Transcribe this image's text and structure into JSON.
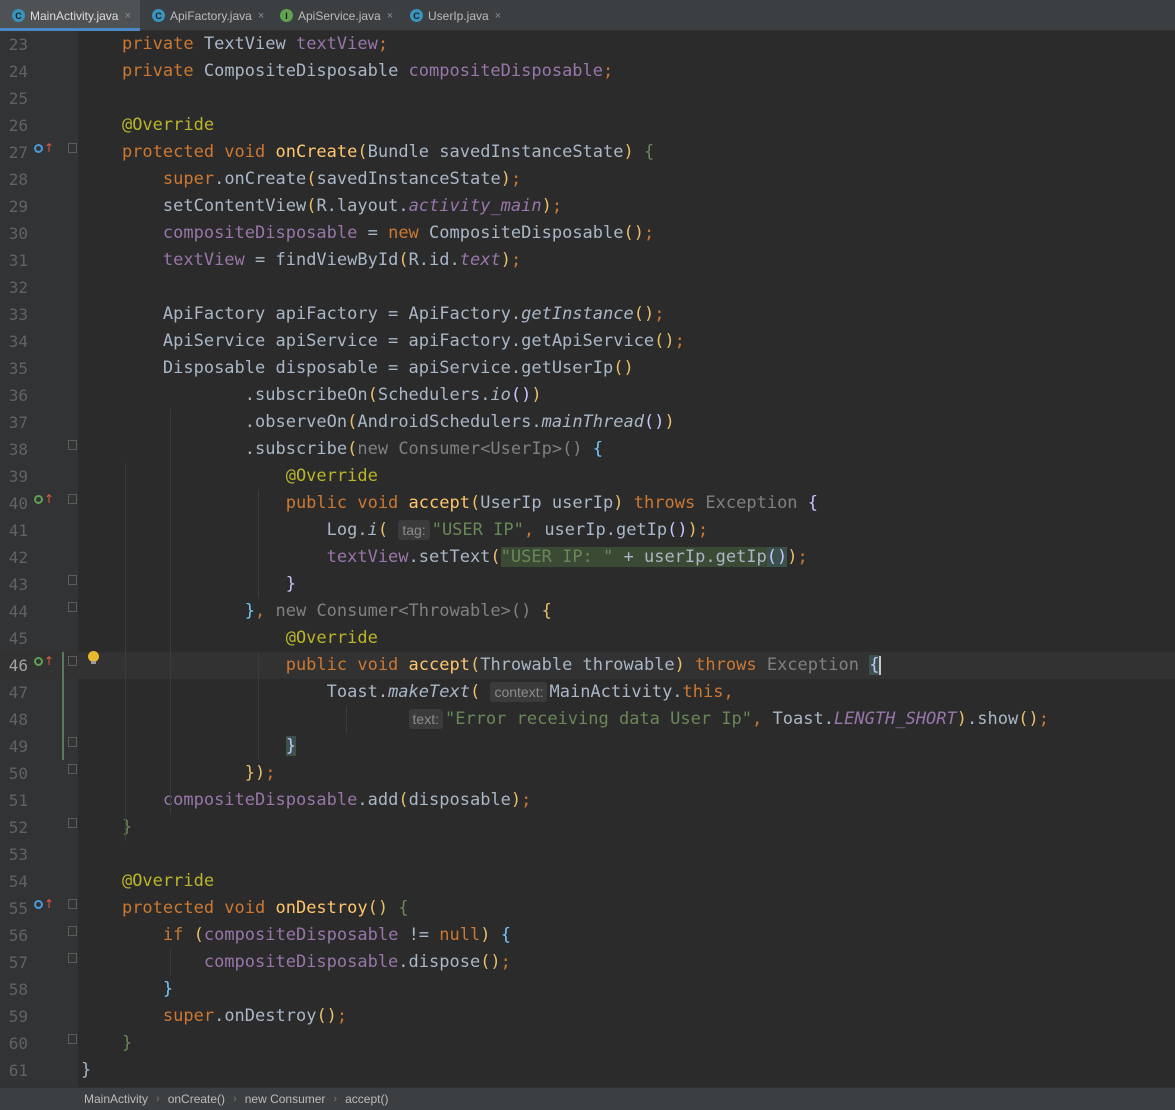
{
  "tabs": [
    {
      "label": "MainActivity.java",
      "icon": "C",
      "icon_name": "class-icon",
      "active": true
    },
    {
      "label": "ApiFactory.java",
      "icon": "C",
      "icon_name": "class-icon",
      "active": false
    },
    {
      "label": "ApiService.java",
      "icon": "I",
      "icon_name": "interface-icon",
      "active": false
    },
    {
      "label": "UserIp.java",
      "icon": "C",
      "icon_name": "class-icon",
      "active": false
    }
  ],
  "close_glyph": "×",
  "breadcrumb": [
    "MainActivity",
    "onCreate()",
    "new Consumer",
    "accept()"
  ],
  "breadcrumb_separator": "›",
  "current_line": 46,
  "colors": {
    "keyword": "#cc7832",
    "method": "#ffc66d",
    "field": "#9876aa",
    "annotation": "#bbb529",
    "string": "#6a8759",
    "background": "#2b2b2b"
  },
  "code": [
    {
      "n": "23",
      "t": [
        [
          "    ",
          ""
        ],
        [
          "private ",
          "k"
        ],
        [
          "TextView ",
          ""
        ],
        [
          "textView",
          "fd"
        ],
        [
          ";",
          "k"
        ]
      ]
    },
    {
      "n": "24",
      "t": [
        [
          "    ",
          ""
        ],
        [
          "private ",
          "k"
        ],
        [
          "CompositeDisposable ",
          ""
        ],
        [
          "compositeDisposable",
          "fd"
        ],
        [
          ";",
          "k"
        ]
      ]
    },
    {
      "n": "25",
      "t": []
    },
    {
      "n": "26",
      "t": [
        [
          "    ",
          ""
        ],
        [
          "@Override",
          "a"
        ]
      ]
    },
    {
      "n": "27",
      "t": [
        [
          "    ",
          ""
        ],
        [
          "protected void ",
          "k"
        ],
        [
          "onCreate",
          "f"
        ],
        [
          "(",
          "b1"
        ],
        [
          "Bundle savedInstanceState",
          ""
        ],
        [
          ")",
          "b1"
        ],
        [
          " ",
          ""
        ],
        [
          "{",
          "s"
        ]
      ]
    },
    {
      "n": "28",
      "t": [
        [
          "        ",
          ""
        ],
        [
          "super",
          "k"
        ],
        [
          ".onCreate",
          ""
        ],
        [
          "(",
          "b1"
        ],
        [
          "savedInstanceState",
          ""
        ],
        [
          ")",
          "b1"
        ],
        [
          ";",
          "k"
        ]
      ]
    },
    {
      "n": "29",
      "t": [
        [
          "        ",
          ""
        ],
        [
          "setContentView",
          ""
        ],
        [
          "(",
          "b1"
        ],
        [
          "R.layout.",
          ""
        ],
        [
          "activity_main",
          "ist"
        ],
        [
          ")",
          "b1"
        ],
        [
          ";",
          "k"
        ]
      ]
    },
    {
      "n": "30",
      "t": [
        [
          "        ",
          ""
        ],
        [
          "compositeDisposable",
          "fd"
        ],
        [
          " = ",
          ""
        ],
        [
          "new ",
          "k"
        ],
        [
          "CompositeDisposable",
          ""
        ],
        [
          "()",
          "b1"
        ],
        [
          ";",
          "k"
        ]
      ]
    },
    {
      "n": "31",
      "t": [
        [
          "        ",
          ""
        ],
        [
          "textView",
          "fd"
        ],
        [
          " = findViewById",
          ""
        ],
        [
          "(",
          "b1"
        ],
        [
          "R.id.",
          ""
        ],
        [
          "text",
          "ist"
        ],
        [
          ")",
          "b1"
        ],
        [
          ";",
          "k"
        ]
      ]
    },
    {
      "n": "32",
      "t": []
    },
    {
      "n": "33",
      "t": [
        [
          "        ",
          ""
        ],
        [
          "ApiFactory apiFactory = ApiFactory.",
          ""
        ],
        [
          "getInstance",
          "sm"
        ],
        [
          "()",
          "b1"
        ],
        [
          ";",
          "k"
        ]
      ]
    },
    {
      "n": "34",
      "t": [
        [
          "        ",
          ""
        ],
        [
          "ApiService apiService = apiFactory.getApiService",
          ""
        ],
        [
          "()",
          "b1"
        ],
        [
          ";",
          "k"
        ]
      ]
    },
    {
      "n": "35",
      "t": [
        [
          "        ",
          ""
        ],
        [
          "Disposable disposable = apiService.getUserIp",
          ""
        ],
        [
          "()",
          "b1"
        ]
      ]
    },
    {
      "n": "36",
      "t": [
        [
          "                ",
          ""
        ],
        [
          ".subscribeOn",
          ""
        ],
        [
          "(",
          "b1"
        ],
        [
          "Schedulers.",
          ""
        ],
        [
          "io",
          "sm"
        ],
        [
          "()",
          "b2"
        ],
        [
          ")",
          "b1"
        ]
      ]
    },
    {
      "n": "37",
      "t": [
        [
          "                ",
          ""
        ],
        [
          ".observeOn",
          ""
        ],
        [
          "(",
          "b1"
        ],
        [
          "AndroidSchedulers.",
          ""
        ],
        [
          "mainThread",
          "sm"
        ],
        [
          "()",
          "b2"
        ],
        [
          ")",
          "b1"
        ]
      ]
    },
    {
      "n": "38",
      "t": [
        [
          "                ",
          ""
        ],
        [
          ".subscribe",
          ""
        ],
        [
          "(",
          "b1"
        ],
        [
          "new Consumer<UserIp>() ",
          "g"
        ],
        [
          "{",
          "b3"
        ]
      ]
    },
    {
      "n": "39",
      "t": [
        [
          "                    ",
          ""
        ],
        [
          "@Override",
          "a"
        ]
      ]
    },
    {
      "n": "40",
      "t": [
        [
          "                    ",
          ""
        ],
        [
          "public void ",
          "k"
        ],
        [
          "accept",
          "f"
        ],
        [
          "(",
          "b1"
        ],
        [
          "UserIp userIp",
          ""
        ],
        [
          ")",
          "b1"
        ],
        [
          " ",
          ""
        ],
        [
          "throws ",
          "k"
        ],
        [
          "Exception ",
          "g"
        ],
        [
          "{",
          "b2"
        ]
      ]
    },
    {
      "n": "41",
      "t": [
        [
          "                        ",
          ""
        ],
        [
          "Log.",
          ""
        ],
        [
          "i",
          "sm"
        ],
        [
          "(",
          "b1"
        ],
        [
          " ",
          ""
        ],
        [
          "tag:",
          "hint"
        ],
        [
          "\"USER IP\"",
          "s"
        ],
        [
          ", ",
          "k"
        ],
        [
          "userIp.getIp",
          ""
        ],
        [
          "()",
          "b2"
        ],
        [
          ")",
          "b1"
        ],
        [
          ";",
          "k"
        ]
      ]
    },
    {
      "n": "42",
      "t": [
        [
          "                        ",
          ""
        ],
        [
          "textView",
          "fd"
        ],
        [
          ".setText",
          ""
        ],
        [
          "(",
          "b1"
        ],
        [
          "\"USER IP: \"",
          "s hl"
        ],
        [
          " + userIp.getIp",
          "hl"
        ],
        [
          "()",
          "b2 hl2"
        ],
        [
          ")",
          "b1"
        ],
        [
          ";",
          "k"
        ]
      ]
    },
    {
      "n": "43",
      "t": [
        [
          "                    ",
          ""
        ],
        [
          "}",
          "b2"
        ]
      ]
    },
    {
      "n": "44",
      "t": [
        [
          "                ",
          ""
        ],
        [
          "}",
          "b3"
        ],
        [
          ", ",
          "k"
        ],
        [
          "new Consumer<Throwable>() ",
          "g"
        ],
        [
          "{",
          "b1"
        ]
      ]
    },
    {
      "n": "45",
      "t": [
        [
          "                    ",
          ""
        ],
        [
          "@Override",
          "a"
        ]
      ]
    },
    {
      "n": "46",
      "t": [
        [
          "                    ",
          ""
        ],
        [
          "public void ",
          "k"
        ],
        [
          "accept",
          "f"
        ],
        [
          "(",
          "b1"
        ],
        [
          "Throwable throwable",
          ""
        ],
        [
          ")",
          "b1"
        ],
        [
          " ",
          ""
        ],
        [
          "throws ",
          "k"
        ],
        [
          "Exception ",
          "g"
        ],
        [
          "{",
          "b2 hl2"
        ],
        [
          "",
          "caret"
        ]
      ]
    },
    {
      "n": "47",
      "t": [
        [
          "                        ",
          ""
        ],
        [
          "Toast.",
          ""
        ],
        [
          "makeText",
          "sm"
        ],
        [
          "(",
          "b1"
        ],
        [
          " ",
          ""
        ],
        [
          "context:",
          "hint"
        ],
        [
          "MainActivity.",
          ""
        ],
        [
          "this",
          "k"
        ],
        [
          ",",
          "k"
        ]
      ]
    },
    {
      "n": "48",
      "t": [
        [
          "                                ",
          ""
        ],
        [
          "text:",
          "hint"
        ],
        [
          "\"Error receiving data User Ip\"",
          "s"
        ],
        [
          ", ",
          "k"
        ],
        [
          "Toast.",
          ""
        ],
        [
          "LENGTH_SHORT",
          "ist"
        ],
        [
          ")",
          "b1"
        ],
        [
          ".show",
          ""
        ],
        [
          "()",
          "b1"
        ],
        [
          ";",
          "k"
        ]
      ]
    },
    {
      "n": "49",
      "t": [
        [
          "                    ",
          ""
        ],
        [
          "}",
          "b2 hl2"
        ]
      ]
    },
    {
      "n": "50",
      "t": [
        [
          "                ",
          ""
        ],
        [
          "}",
          "b1"
        ],
        [
          ")",
          "b1"
        ],
        [
          ";",
          "k"
        ]
      ]
    },
    {
      "n": "51",
      "t": [
        [
          "        ",
          ""
        ],
        [
          "compositeDisposable",
          "fd"
        ],
        [
          ".add",
          ""
        ],
        [
          "(",
          "b1"
        ],
        [
          "disposable",
          ""
        ],
        [
          ")",
          "b1"
        ],
        [
          ";",
          "k"
        ]
      ]
    },
    {
      "n": "52",
      "t": [
        [
          "    ",
          ""
        ],
        [
          "}",
          "s"
        ]
      ]
    },
    {
      "n": "53",
      "t": []
    },
    {
      "n": "54",
      "t": [
        [
          "    ",
          ""
        ],
        [
          "@Override",
          "a"
        ]
      ]
    },
    {
      "n": "55",
      "t": [
        [
          "    ",
          ""
        ],
        [
          "protected void ",
          "k"
        ],
        [
          "onDestroy",
          "f"
        ],
        [
          "()",
          "b1"
        ],
        [
          " ",
          ""
        ],
        [
          "{",
          "s"
        ]
      ]
    },
    {
      "n": "56",
      "t": [
        [
          "        ",
          ""
        ],
        [
          "if ",
          "k"
        ],
        [
          "(",
          "b1"
        ],
        [
          "compositeDisposable",
          "fd"
        ],
        [
          " != ",
          ""
        ],
        [
          "null",
          "k"
        ],
        [
          ")",
          "b1"
        ],
        [
          " ",
          ""
        ],
        [
          "{",
          "b3"
        ]
      ]
    },
    {
      "n": "57",
      "t": [
        [
          "            ",
          ""
        ],
        [
          "compositeDisposable",
          "fd"
        ],
        [
          ".dispose",
          ""
        ],
        [
          "()",
          "b1"
        ],
        [
          ";",
          "k"
        ]
      ]
    },
    {
      "n": "58",
      "t": [
        [
          "        ",
          ""
        ],
        [
          "}",
          "b3"
        ]
      ]
    },
    {
      "n": "59",
      "t": [
        [
          "        ",
          ""
        ],
        [
          "super",
          "k"
        ],
        [
          ".onDestroy",
          ""
        ],
        [
          "()",
          "b1"
        ],
        [
          ";",
          "k"
        ]
      ]
    },
    {
      "n": "60",
      "t": [
        [
          "    ",
          ""
        ],
        [
          "}",
          "s"
        ]
      ]
    },
    {
      "n": "61",
      "t": [
        [
          "}",
          ""
        ]
      ]
    }
  ]
}
